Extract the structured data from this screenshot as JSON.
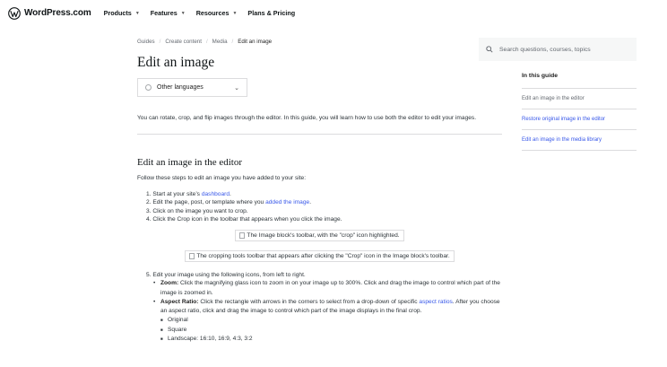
{
  "nav": {
    "logo_text": "WordPress.com",
    "links": [
      {
        "label": "Products"
      },
      {
        "label": "Features"
      },
      {
        "label": "Resources"
      },
      {
        "label": "Plans & Pricing"
      }
    ]
  },
  "breadcrumb": [
    "Guides",
    "Create content",
    "Media",
    "Edit an image"
  ],
  "page_title": "Edit an image",
  "language_select": "Other languages",
  "intro": "You can rotate, crop, and flip images through the editor. In this guide, you will learn how to use both the editor to edit your images.",
  "section1": {
    "heading": "Edit an image in the editor",
    "lead": "Follow these steps to edit an image you have added to your site:",
    "step1_pre": "1. Start at your site’s ",
    "step1_link": "dashboard",
    "step1_post": ".",
    "step2_pre": "2. Edit the page, post, or template where you ",
    "step2_link": "added the image",
    "step2_post": ".",
    "step3": "3. Click on the image you want to crop.",
    "step4": "4. Click the Crop icon in the toolbar that appears when you click the image.",
    "img1_alt": "The Image block's toolbar, with the \"crop\" icon highlighted.",
    "img2_alt": "The cropping tools toolbar that appears after clicking the \"Crop\" icon in the Image block's toolbar.",
    "step5": "5. Edit your image using the following icons, from left to right.",
    "zoom_label": "Zoom:",
    "zoom_text": " Click the magnifying glass icon to zoom in on your image up to 300%. Click and drag the image to control which part of the image is zoomed in.",
    "aspect_label": "Aspect Ratio:",
    "aspect_text_pre": " Click the rectangle with arrows in the corners to select from a drop-down of specific ",
    "aspect_link": "aspect ratios",
    "aspect_text_post": ". After you choose an aspect ratio, click and drag the image to control which part of the image displays in the final crop.",
    "aspect_options": [
      "Original",
      "Square",
      "Landscape: 16:10, 16:9, 4:3, 3:2"
    ]
  },
  "sidebar": {
    "search_placeholder": "Search questions, courses, topics",
    "toc_title": "In this guide",
    "toc_items": [
      "Edit an image in the editor",
      "Restore original image in the editor",
      "Edit an image in the media library"
    ]
  }
}
